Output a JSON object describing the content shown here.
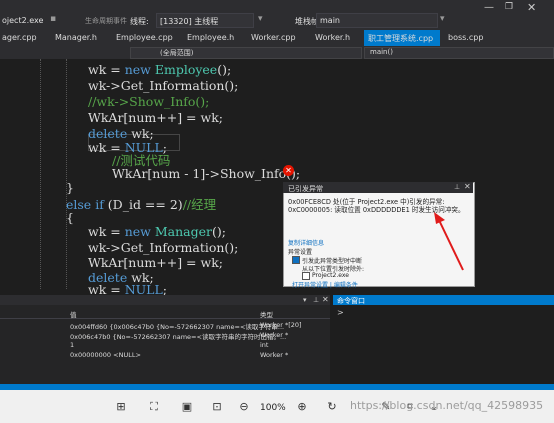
{
  "toolbar": {
    "process": "oject2.exe",
    "lifecycle": "生命周期事件",
    "thread_label": "线程:",
    "thread_value": "[13320] 主线程",
    "stack_label": "堆栈帧:",
    "stack_value": "main"
  },
  "tabs": [
    {
      "label": "ager.cpp"
    },
    {
      "label": "Manager.h"
    },
    {
      "label": "Employee.cpp"
    },
    {
      "label": "Employee.h"
    },
    {
      "label": "Worker.cpp"
    },
    {
      "label": "Worker.h"
    },
    {
      "label": "职工管理系统.cpp"
    },
    {
      "label": "boss.cpp"
    }
  ],
  "nav": {
    "scope": "(全局范围)",
    "function": "main()"
  },
  "code_lines": [
    "wk = new Employee();",
    "wk->Get_Information();",
    "//wk->Show_Info();",
    "WkAr[num++] = wk;",
    "delete wk;",
    "wk = NULL;",
    "//测试代码",
    "WkAr[num - 1]->Show_Info();",
    "}",
    "else if (D_id == 2)//经理",
    "{",
    "wk = new Manager();",
    "wk->Get_Information();",
    "WkAr[num++] = wk;",
    "delete wk;",
    "wk = NULL;"
  ],
  "exception": {
    "title": "已引发异常",
    "message": "0x00FCE8CD 处(位于 Project2.exe 中)引发的异常: 0xC0000005: 读取位置 0xDDDDDDE1 时发生访问冲突。",
    "link": "复制详细信息",
    "settings_title": "异常设置",
    "opt1": "引发此异常类型时中断",
    "opt2": "从以下位置引发时除外:",
    "opt3": "Project2.exe",
    "opt4": "打开异常设置 | 编辑条件"
  },
  "locals": {
    "col_value": "值",
    "col_type": "类型",
    "rows": [
      {
        "value": "0x004ffd60 {0x006c47b0 {No=-572662307 name=<读取字符串...",
        "type": "Worker *[20]"
      },
      {
        "value": "0x006c47b0 {No=-572662307 name=<读取字符串的字符时出错。...",
        "type": "Worker *"
      },
      {
        "value": "1",
        "type": "int"
      },
      {
        "value": "0x00000000 <NULL>",
        "type": "Worker *"
      }
    ]
  },
  "command_window": {
    "title": "命令窗口",
    "prompt": ">"
  },
  "viewer": {
    "zoom": "100%",
    "watermark": "https://blog.csdn.net/qq_42598935"
  },
  "colors": {
    "accent": "#007acc",
    "keyword": "#569cd6",
    "type": "#4ec9b0",
    "comment": "#57a64a",
    "error": "#e51400"
  }
}
